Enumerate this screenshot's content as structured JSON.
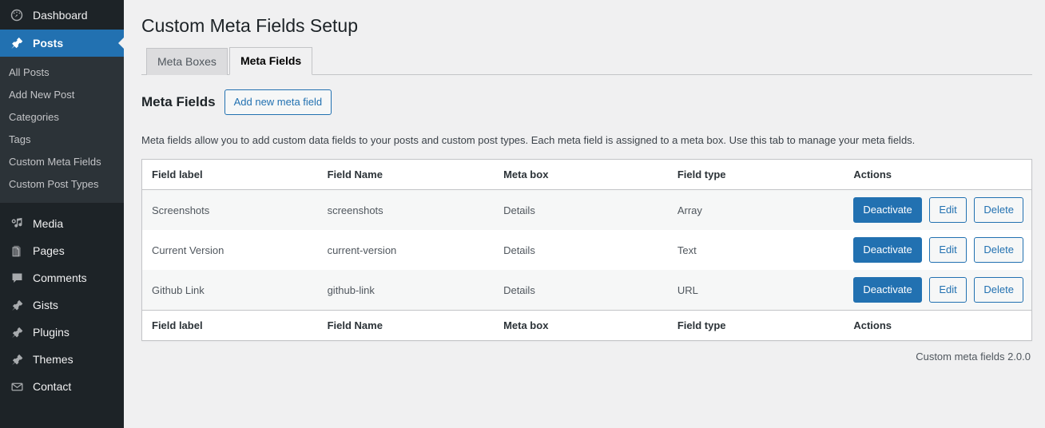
{
  "sidebar": {
    "items": [
      {
        "label": "Dashboard",
        "icon": "dashboard-icon",
        "current": false
      },
      {
        "label": "Posts",
        "icon": "pin-icon",
        "current": true
      }
    ],
    "submenu": [
      {
        "label": "All Posts"
      },
      {
        "label": "Add New Post"
      },
      {
        "label": "Categories"
      },
      {
        "label": "Tags"
      },
      {
        "label": "Custom Meta Fields"
      },
      {
        "label": "Custom Post Types"
      }
    ],
    "items_lower": [
      {
        "label": "Media",
        "icon": "media-icon"
      },
      {
        "label": "Pages",
        "icon": "pages-icon"
      },
      {
        "label": "Comments",
        "icon": "comments-icon"
      },
      {
        "label": "Gists",
        "icon": "pin-icon"
      },
      {
        "label": "Plugins",
        "icon": "pin-icon"
      },
      {
        "label": "Themes",
        "icon": "pin-icon"
      },
      {
        "label": "Contact",
        "icon": "envelope-icon"
      }
    ]
  },
  "page": {
    "title": "Custom Meta Fields Setup",
    "section_title": "Meta Fields",
    "add_button": "Add new meta field",
    "description": "Meta fields allow you to add custom data fields to your posts and custom post types. Each meta field is assigned to a meta box. Use this tab to manage your meta fields.",
    "version": "Custom meta fields 2.0.0"
  },
  "tabs": [
    {
      "label": "Meta Boxes",
      "active": false
    },
    {
      "label": "Meta Fields",
      "active": true
    }
  ],
  "table": {
    "columns": [
      "Field label",
      "Field Name",
      "Meta box",
      "Field type",
      "Actions"
    ],
    "rows": [
      {
        "field_label": "Screenshots",
        "field_name": "screenshots",
        "meta_box": "Details",
        "field_type": "Array",
        "actions": [
          "Deactivate",
          "Edit",
          "Delete"
        ]
      },
      {
        "field_label": "Current Version",
        "field_name": "current-version",
        "meta_box": "Details",
        "field_type": "Text",
        "actions": [
          "Deactivate",
          "Edit",
          "Delete"
        ]
      },
      {
        "field_label": "Github Link",
        "field_name": "github-link",
        "meta_box": "Details",
        "field_type": "URL",
        "actions": [
          "Deactivate",
          "Edit",
          "Delete"
        ]
      }
    ]
  },
  "colors": {
    "admin_blue": "#2271b1",
    "sidebar_dark": "#1d2327",
    "submenu_dark": "#2c3338",
    "page_bg": "#f0f0f1"
  }
}
